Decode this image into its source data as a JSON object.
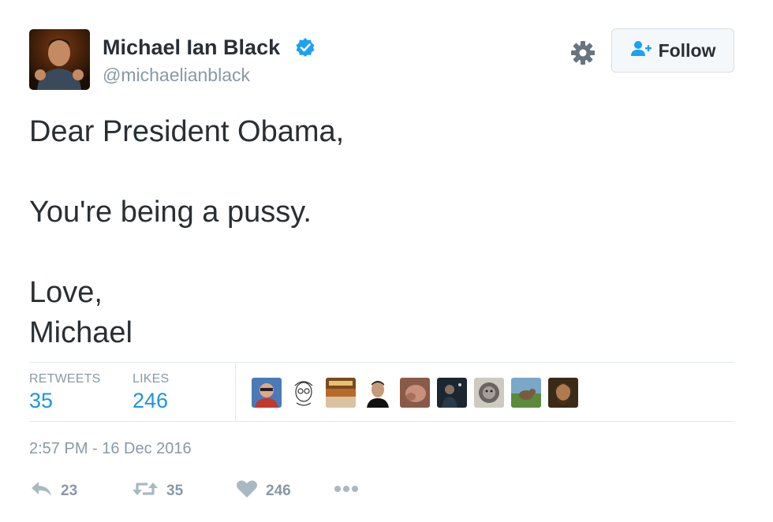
{
  "user": {
    "name": "Michael Ian Black",
    "handle": "@michaelianblack",
    "avatar_icon": "profile-photo",
    "verified_icon": "verified-badge-icon"
  },
  "header": {
    "settings_icon": "gear-icon",
    "follow_label": "Follow",
    "follow_icon": "add-user-icon"
  },
  "tweet": {
    "lines": [
      "Dear President Obama,",
      "You're being a pussy.",
      "Love,",
      "Michael"
    ]
  },
  "stats": {
    "retweets_label": "RETWEETS",
    "retweets_count": "35",
    "likes_label": "LIKES",
    "likes_count": "246"
  },
  "timestamp": "2:57 PM - 16 Dec 2016",
  "actions": {
    "reply_count": "23",
    "retweet_count": "35",
    "like_count": "246",
    "more_icon": "more-icon"
  },
  "colors": {
    "text": "#292f33",
    "muted": "#8899a6",
    "link": "#1b95e0",
    "verified": "#1da1f2",
    "border": "#e1e8ed"
  }
}
